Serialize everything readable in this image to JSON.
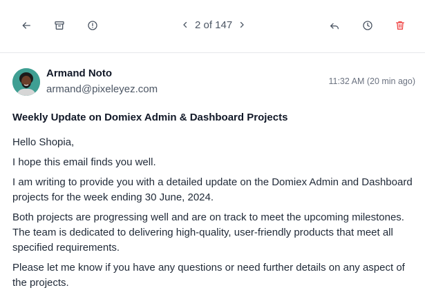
{
  "toolbar": {
    "pagination": "2 of 147",
    "icons": [
      "back-arrow-icon",
      "archive-icon",
      "alert-circle-icon",
      "chevron-left-icon",
      "chevron-right-icon",
      "reply-icon",
      "clock-icon",
      "trash-icon"
    ],
    "delete_color": "#ef4444"
  },
  "message": {
    "sender_name": "Armand Noto",
    "sender_email": "armand@pixeleyez.com",
    "timestamp": "11:32 AM (20 min ago)",
    "subject": "Weekly Update on Domiex Admin & Dashboard Projects",
    "paragraphs": [
      "Hello Shopia,",
      "I hope this email finds you well.",
      "I am writing to provide you with a detailed update on the Domiex Admin and Dashboard projects for the week ending 30 June, 2024.",
      "Both projects are progressing well and are on track to meet the upcoming milestones. The team is dedicated to delivering high-quality, user-friendly products that meet all specified requirements.",
      "Please let me know if you have any questions or need further details on any aspect of the projects."
    ]
  }
}
